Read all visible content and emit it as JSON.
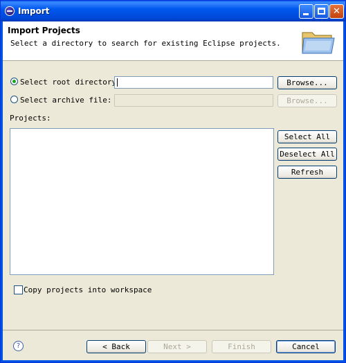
{
  "window": {
    "title": "Import"
  },
  "header": {
    "title": "Import Projects",
    "description": "Select a directory to search for existing Eclipse projects."
  },
  "source": {
    "root_dir_label": "Select root directory:",
    "root_dir_value": "",
    "archive_label": "Select archive file:",
    "archive_value": "",
    "browse_label": "Browse...",
    "browse_archive_label": "Browse..."
  },
  "projects": {
    "label": "Projects:",
    "items": [],
    "select_all_label": "Select All",
    "deselect_all_label": "Deselect All",
    "refresh_label": "Refresh"
  },
  "options": {
    "copy_label": "Copy projects into workspace"
  },
  "footer": {
    "back_label": "< Back",
    "next_label": "Next >",
    "finish_label": "Finish",
    "cancel_label": "Cancel"
  }
}
